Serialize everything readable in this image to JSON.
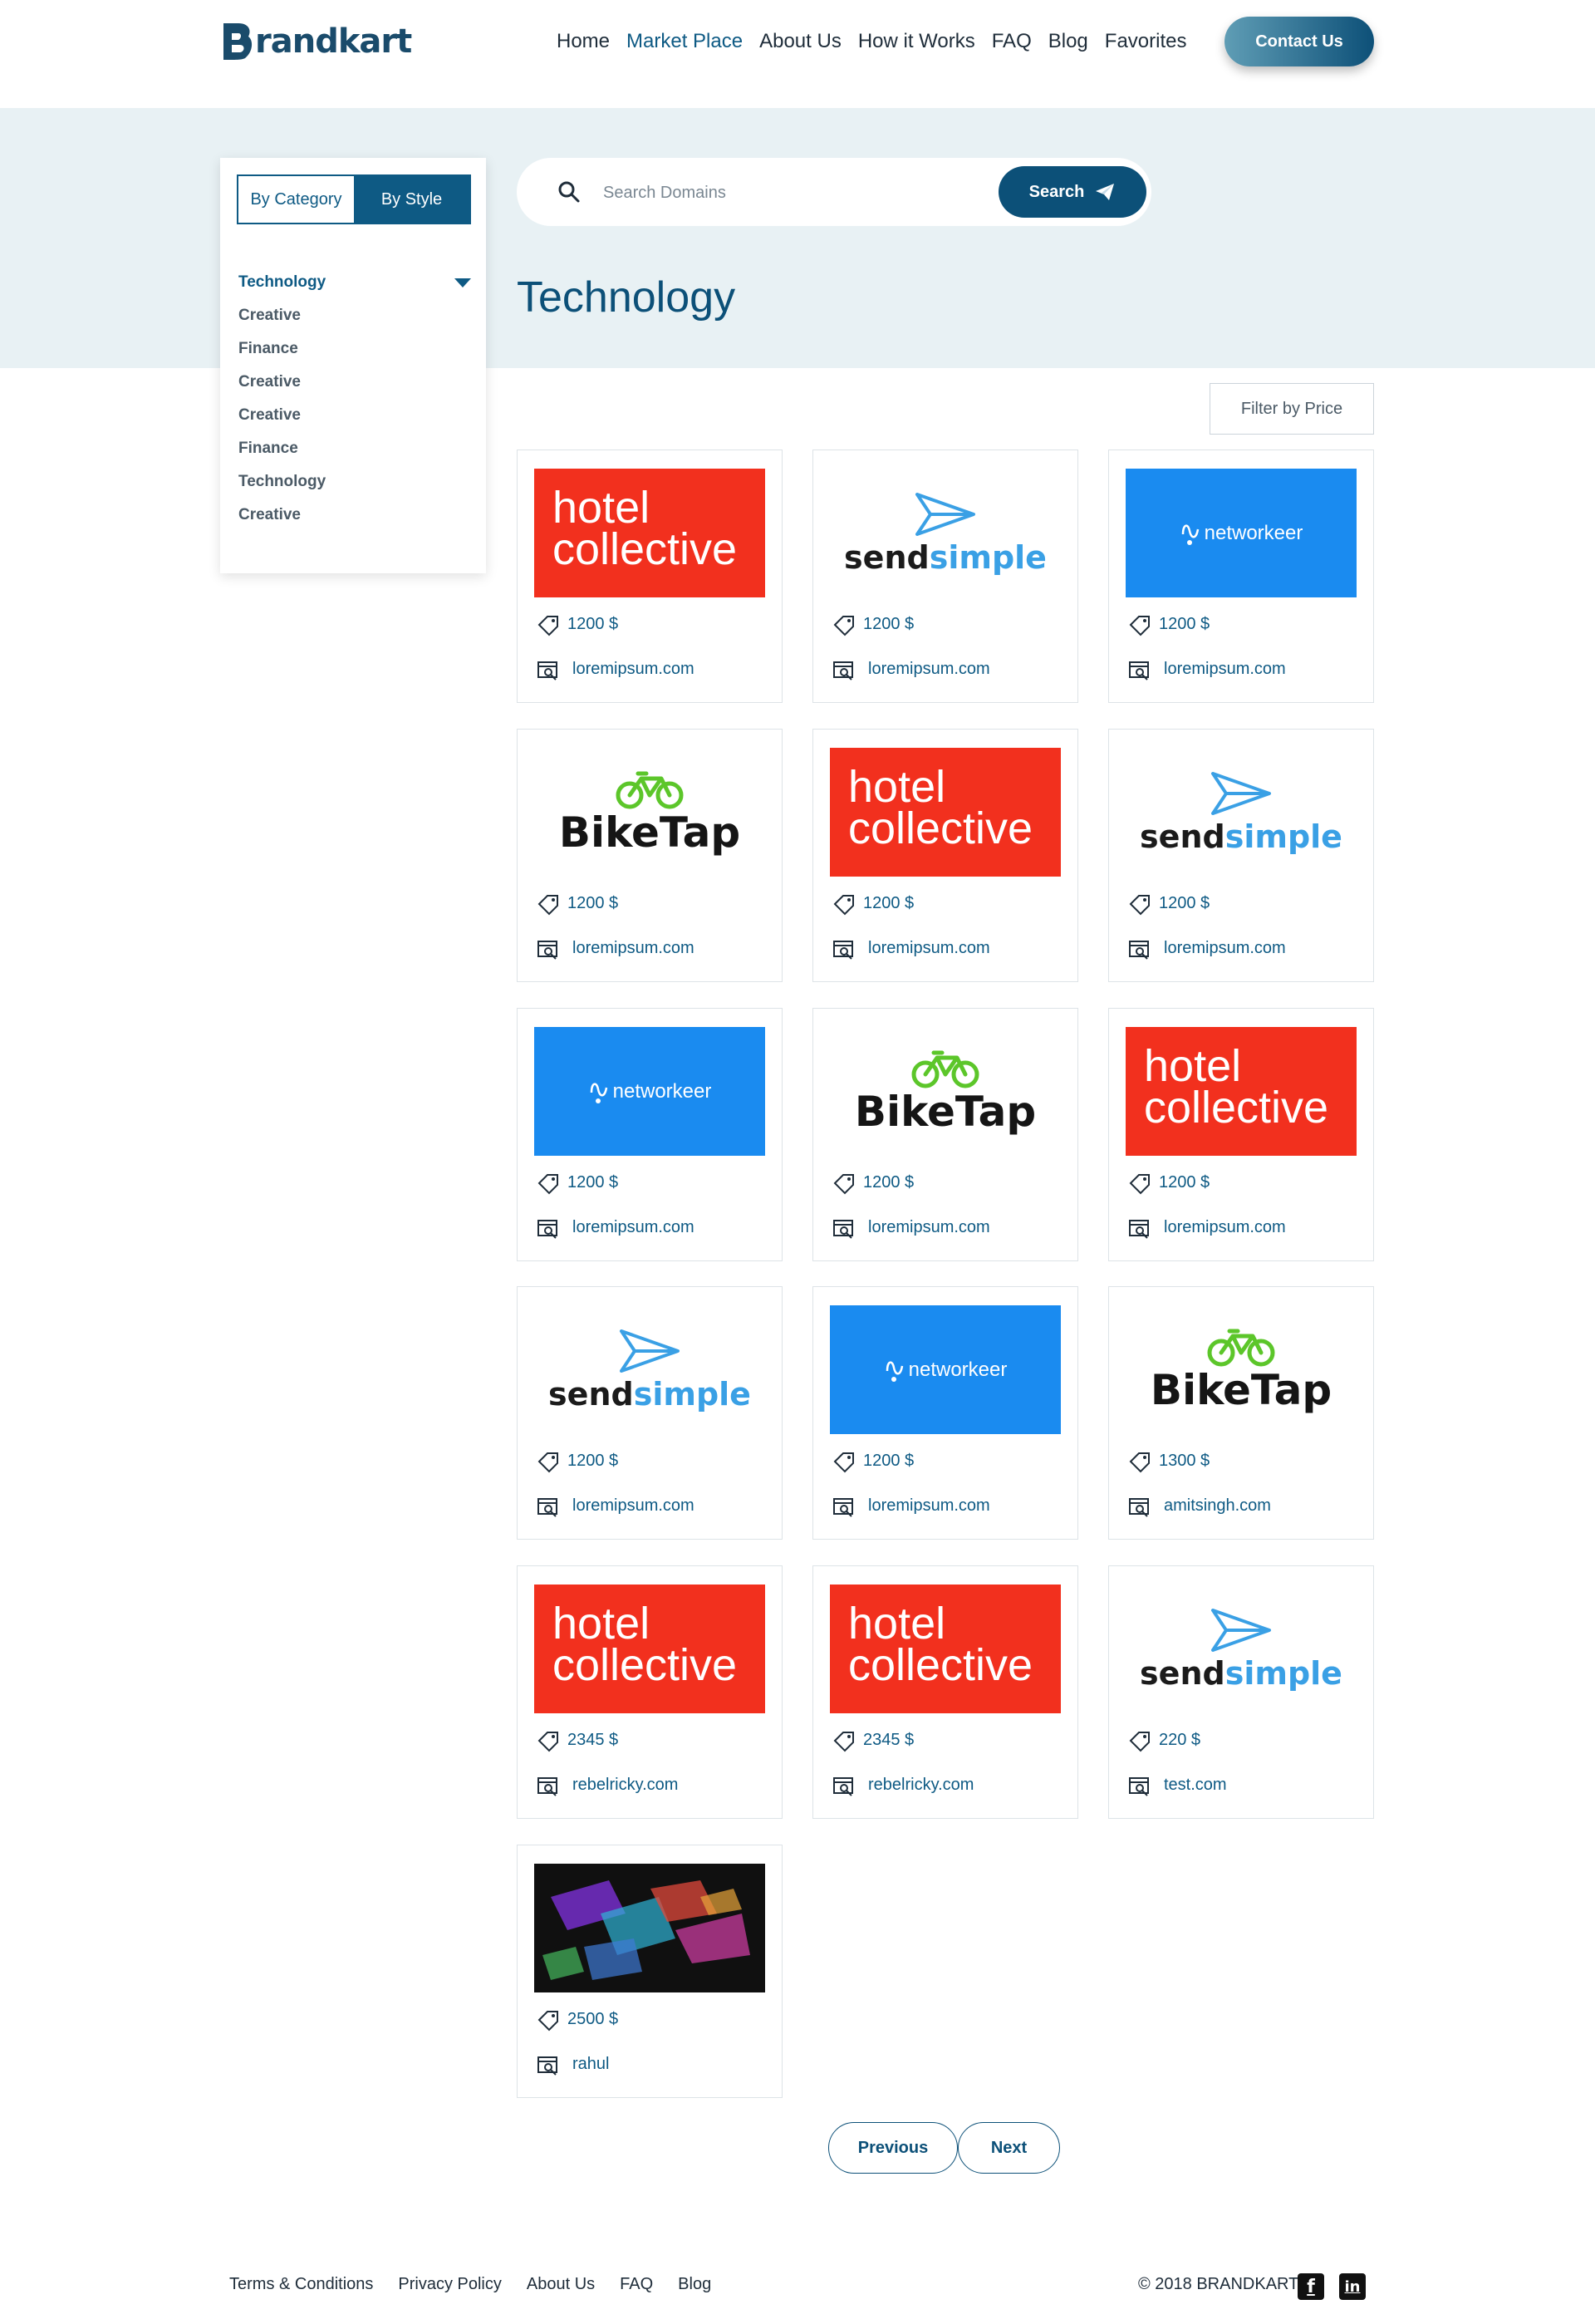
{
  "brand": {
    "name": "randkart",
    "initial": "B"
  },
  "nav": [
    "Home",
    "Market Place",
    "About Us",
    "How it Works",
    "FAQ",
    "Blog",
    "Favorites"
  ],
  "nav_active": "Market Place",
  "contact_label": "Contact Us",
  "sidebar": {
    "toggle": [
      "By Category",
      "By Style"
    ],
    "categories": [
      "Technology",
      "Creative",
      "Finance",
      "Creative",
      "Creative",
      "Finance",
      "Technology",
      "Creative"
    ]
  },
  "search": {
    "placeholder": "Search Domains",
    "button": "Search"
  },
  "page_title": "Technology",
  "filter_label": "Filter by Price",
  "listings": [
    {
      "logo": "hotel",
      "price": "1200 $",
      "domain": "loremipsum.com"
    },
    {
      "logo": "send",
      "price": "1200 $",
      "domain": "loremipsum.com"
    },
    {
      "logo": "networkeer",
      "price": "1200 $",
      "domain": "loremipsum.com"
    },
    {
      "logo": "bike",
      "price": "1200 $",
      "domain": "loremipsum.com"
    },
    {
      "logo": "hotel",
      "price": "1200 $",
      "domain": "loremipsum.com"
    },
    {
      "logo": "send",
      "price": "1200 $",
      "domain": "loremipsum.com"
    },
    {
      "logo": "networkeer",
      "price": "1200 $",
      "domain": "loremipsum.com"
    },
    {
      "logo": "bike",
      "price": "1200 $",
      "domain": "loremipsum.com"
    },
    {
      "logo": "hotel",
      "price": "1200 $",
      "domain": "loremipsum.com"
    },
    {
      "logo": "send",
      "price": "1200 $",
      "domain": "loremipsum.com"
    },
    {
      "logo": "networkeer",
      "price": "1200 $",
      "domain": "loremipsum.com"
    },
    {
      "logo": "bike",
      "price": "1300 $",
      "domain": "amitsingh.com"
    },
    {
      "logo": "hotel",
      "price": "2345 $",
      "domain": "rebelricky.com"
    },
    {
      "logo": "hotel",
      "price": "2345 $",
      "domain": "rebelricky.com"
    },
    {
      "logo": "send",
      "price": "220 $",
      "domain": "test.com"
    },
    {
      "logo": "abstract",
      "price": "2500 $",
      "domain": "rahul"
    }
  ],
  "logo_text": {
    "hotel": [
      "hotel",
      "collective"
    ],
    "send": [
      "send",
      "simple"
    ],
    "networkeer": "networkeer",
    "bike": "BikeTap"
  },
  "pagination": {
    "previous": "Previous",
    "next": "Next"
  },
  "footer": {
    "links": [
      "Terms & Conditions",
      "Privacy Policy",
      "About Us",
      "FAQ",
      "Blog"
    ],
    "copyright": "© 2018 BRANDKART",
    "social_fb": "f",
    "social_li": "in"
  },
  "colors": {
    "primary": "#0c5078",
    "hotel_red": "#f2301e",
    "networkeer_blue": "#1a8bf0",
    "band": "#e8f1f4"
  }
}
